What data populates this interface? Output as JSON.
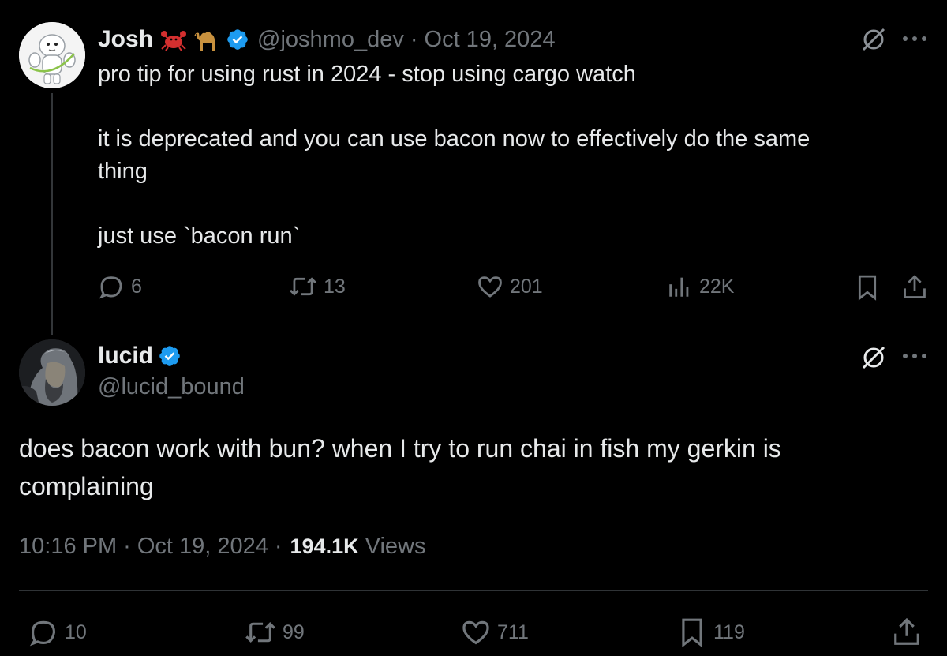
{
  "parent_tweet": {
    "author_name": "Josh",
    "author_emojis": [
      "crab-emoji",
      "camel-emoji"
    ],
    "handle": "@joshmo_dev",
    "date_separator": "·",
    "date": "Oct 19, 2024",
    "body": "pro tip for using rust in 2024 - stop using cargo watch\n\nit is deprecated and you can use bacon now to effectively do the same\nthing\n\njust use `bacon run`",
    "stats": {
      "replies": "6",
      "reposts": "13",
      "likes": "201",
      "views": "22K"
    }
  },
  "reply_tweet": {
    "author_name": "lucid",
    "handle": "@lucid_bound",
    "body": "does bacon work with bun? when I try to run chai in fish my gerkin is\ncomplaining",
    "time": "10:16 PM",
    "date": "Oct 19, 2024",
    "separator": "·",
    "views_count": "194.1K",
    "views_label": "Views",
    "stats": {
      "replies": "10",
      "reposts": "99",
      "likes": "711",
      "bookmarks": "119"
    }
  },
  "colors": {
    "background": "#000000",
    "text_primary": "#e7e9ea",
    "text_secondary": "#71767b",
    "verified_blue": "#1d9bf0",
    "divider": "#2f3336"
  }
}
